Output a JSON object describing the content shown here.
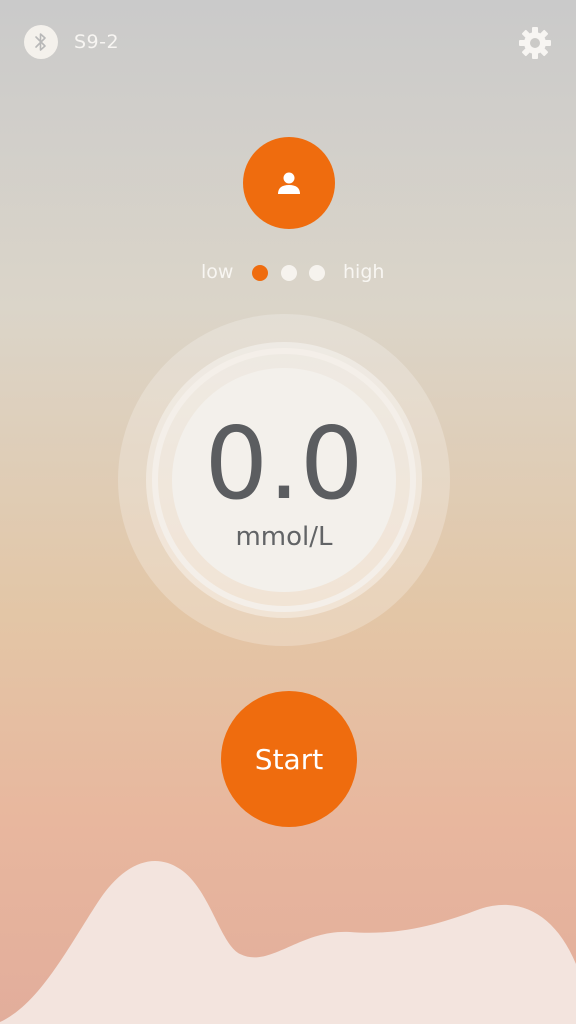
{
  "header": {
    "device_name": "S9-2",
    "bluetooth_icon": "bluetooth-icon",
    "settings_icon": "gear-icon"
  },
  "user": {
    "icon": "user-icon"
  },
  "level": {
    "low_label": "low",
    "high_label": "high",
    "selected_index": 0,
    "count": 3
  },
  "reading": {
    "value": "0.0",
    "unit": "mmol/L"
  },
  "actions": {
    "start_label": "Start"
  },
  "colors": {
    "accent": "#ef6c0e",
    "dot_inactive": "#f6f3ee",
    "text_light": "#f8f6f2",
    "reading_text": "#5b5d60"
  }
}
